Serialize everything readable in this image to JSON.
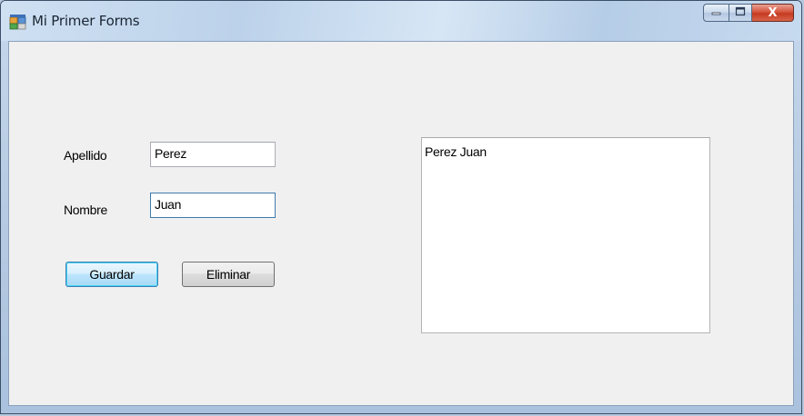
{
  "window": {
    "title": "Mi Primer Forms",
    "icon": "winforms-app-icon"
  },
  "caption_buttons": {
    "minimize_icon": "minimize-icon",
    "maximize_icon": "maximize-icon",
    "close_icon": "close-icon",
    "close_glyph": "X"
  },
  "form": {
    "apellido_label": "Apellido",
    "apellido_value": "Perez",
    "nombre_label": "Nombre",
    "nombre_value": "Juan",
    "guardar_label": "Guardar",
    "eliminar_label": "Eliminar"
  },
  "list": {
    "items": [
      "Perez Juan"
    ]
  },
  "colors": {
    "client_bg": "#f0f0f0",
    "close_red": "#c43a20",
    "focus_border": "#3d7bad"
  }
}
